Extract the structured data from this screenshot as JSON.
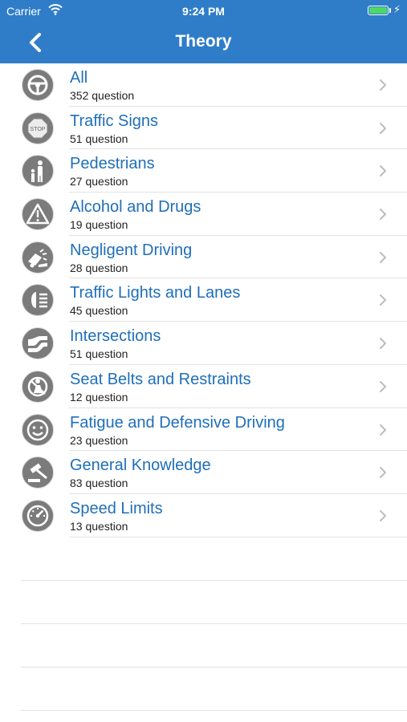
{
  "status_bar": {
    "carrier": "Carrier",
    "time": "9:24 PM",
    "battery_color": "#4cd964"
  },
  "nav": {
    "title": "Theory",
    "back_icon": "chevron-left-icon",
    "bar_color": "#2f7dc9"
  },
  "items": [
    {
      "label": "All",
      "count": "352 question",
      "icon": "steering-wheel-icon"
    },
    {
      "label": "Traffic Signs",
      "count": "51 question",
      "icon": "stop-sign-icon"
    },
    {
      "label": "Pedestrians",
      "count": "27 question",
      "icon": "pedestrian-icon"
    },
    {
      "label": "Alcohol and Drugs",
      "count": "19 question",
      "icon": "warning-triangle-icon"
    },
    {
      "label": "Negligent Driving",
      "count": "28 question",
      "icon": "car-crash-icon"
    },
    {
      "label": "Traffic Lights and Lanes",
      "count": "45 question",
      "icon": "headlight-icon"
    },
    {
      "label": "Intersections",
      "count": "51 question",
      "icon": "intersection-curve-icon"
    },
    {
      "label": "Seat Belts and Restraints",
      "count": "12 question",
      "icon": "seat-belt-icon"
    },
    {
      "label": "Fatigue and Defensive Driving",
      "count": "23 question",
      "icon": "smiley-face-icon"
    },
    {
      "label": "General Knowledge",
      "count": "83 question",
      "icon": "gavel-icon"
    },
    {
      "label": "Speed Limits",
      "count": "13 question",
      "icon": "speedometer-icon"
    }
  ]
}
